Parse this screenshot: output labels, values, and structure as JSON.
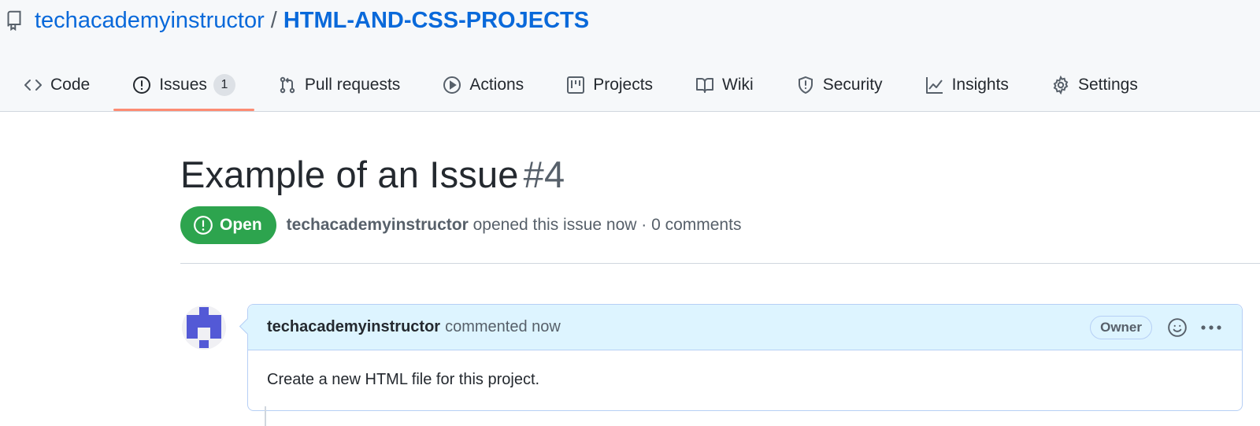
{
  "repo": {
    "owner": "techacademyinstructor",
    "separator": "/",
    "name": "HTML-AND-CSS-PROJECTS",
    "icon": "repo-icon"
  },
  "tabs": [
    {
      "label": "Code",
      "icon": "code-icon",
      "active": false
    },
    {
      "label": "Issues",
      "icon": "issue-opened-icon",
      "active": true,
      "count": "1"
    },
    {
      "label": "Pull requests",
      "icon": "git-pull-request-icon",
      "active": false
    },
    {
      "label": "Actions",
      "icon": "play-icon",
      "active": false
    },
    {
      "label": "Projects",
      "icon": "project-icon",
      "active": false
    },
    {
      "label": "Wiki",
      "icon": "book-icon",
      "active": false
    },
    {
      "label": "Security",
      "icon": "shield-icon",
      "active": false
    },
    {
      "label": "Insights",
      "icon": "graph-icon",
      "active": false
    },
    {
      "label": "Settings",
      "icon": "gear-icon",
      "active": false
    }
  ],
  "issue": {
    "title": "Example of an Issue",
    "number": "#4",
    "state": "Open",
    "author": "techacademyinstructor",
    "meta": "opened this issue now · 0 comments"
  },
  "comment": {
    "author": "techacademyinstructor",
    "action": "commented now",
    "role_badge": "Owner",
    "body": "Create a new HTML file for this project."
  },
  "colors": {
    "link": "#0969da",
    "open_state": "#2da44e",
    "active_tab_underline": "#fd8c73",
    "comment_header_bg": "#ddf4ff",
    "avatar_color": "#5359d6"
  }
}
